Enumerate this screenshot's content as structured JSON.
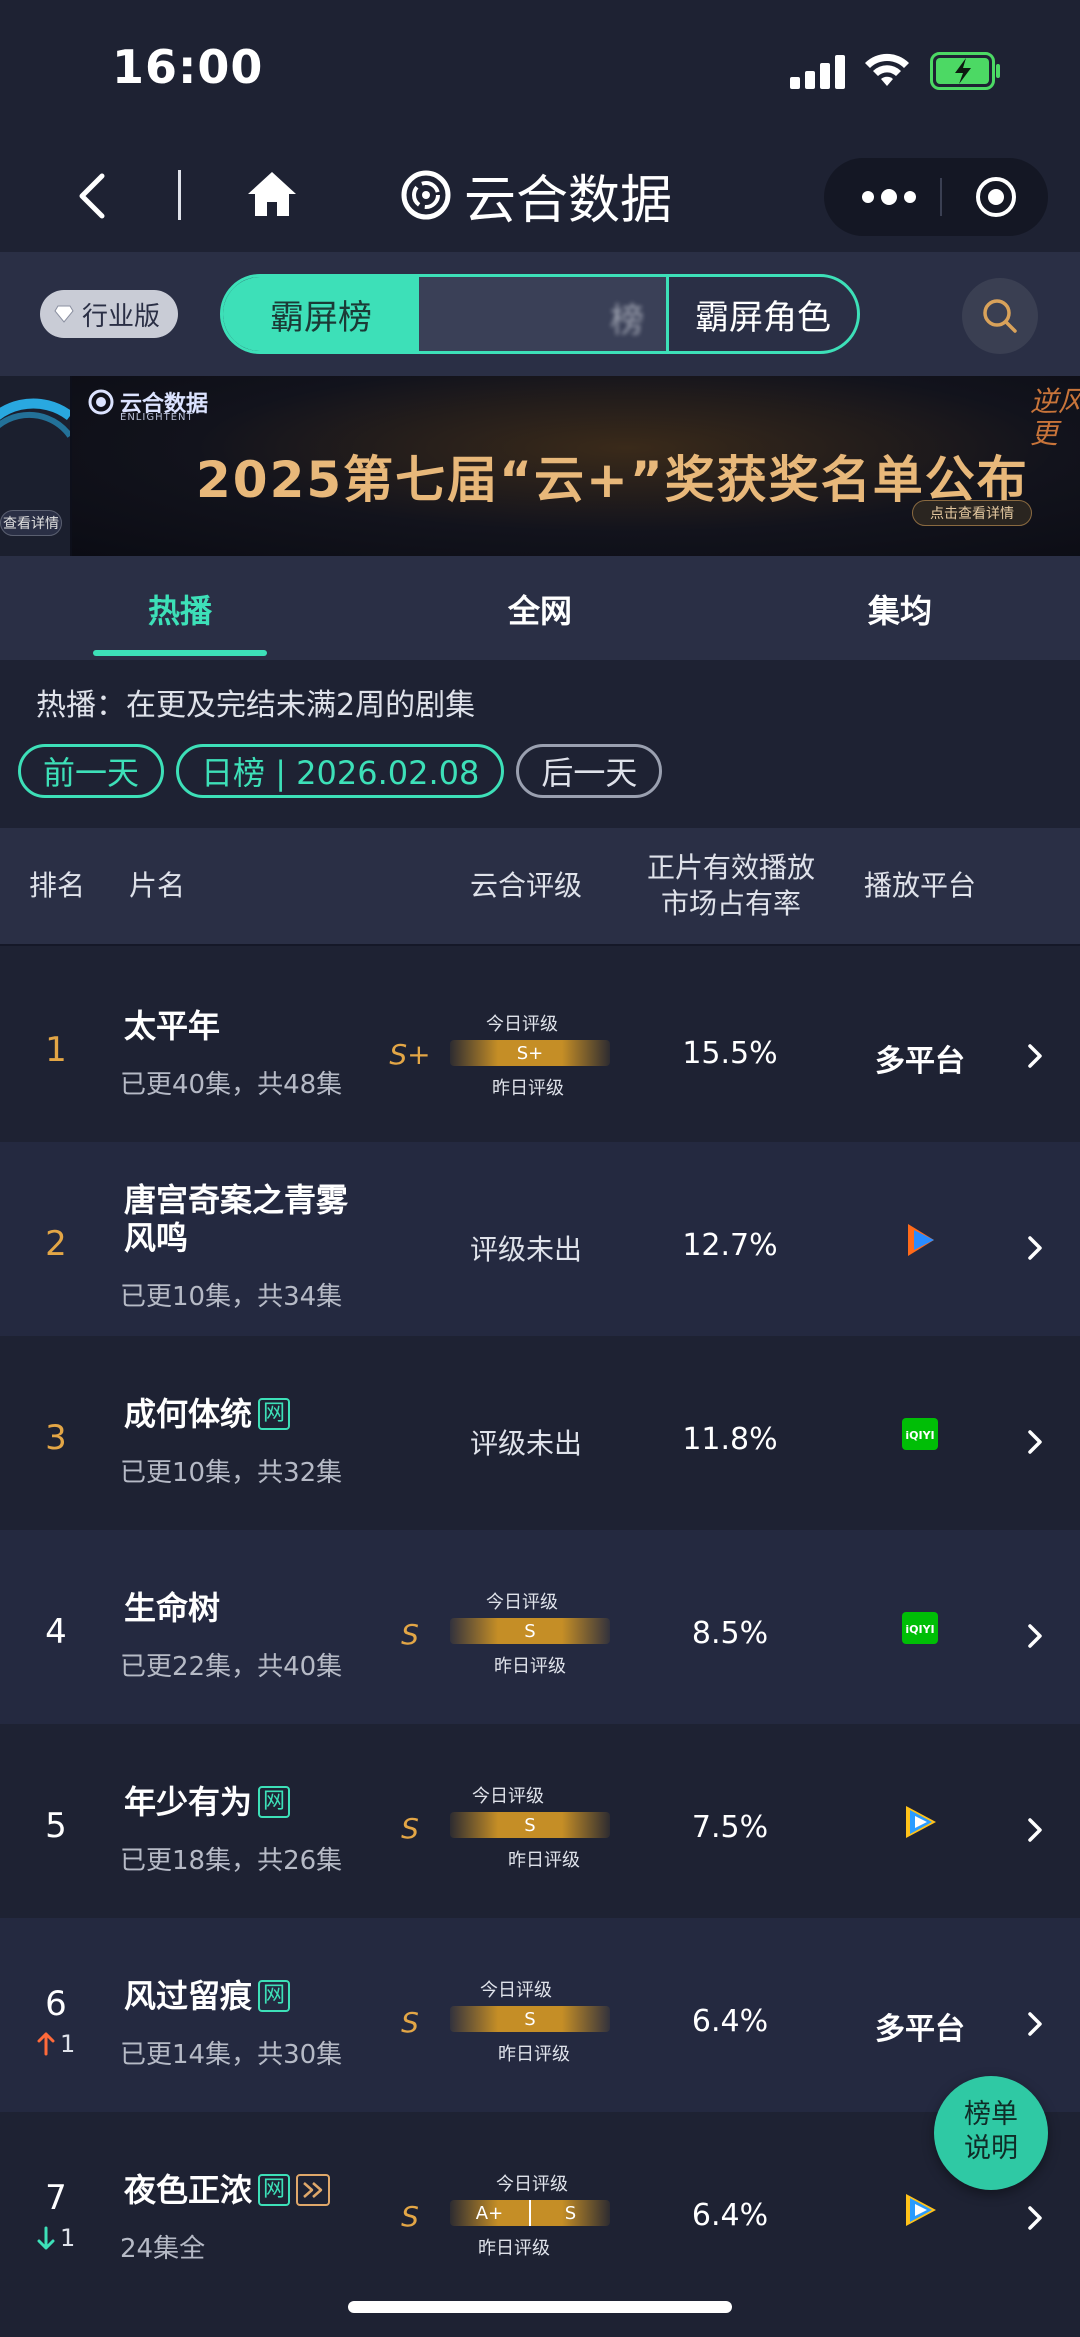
{
  "status": {
    "time": "16:00"
  },
  "nav": {
    "title": "云合数据"
  },
  "filter": {
    "edition": "行业版",
    "segments": [
      "霸屏榜",
      "榜",
      "霸屏角色"
    ]
  },
  "banner": {
    "brand": "云合数据",
    "brand_en": "ENLIGHTENT",
    "headline": "2025第七届“云+”奖获奖名单公布",
    "cta": "点击查看详情",
    "left_cta": "查看详情",
    "right_peek": "逆风更"
  },
  "tabs": [
    "热播",
    "全网",
    "集均"
  ],
  "description": "热播：在更及完结未满2周的剧集",
  "date": {
    "prev": "前一天",
    "current": "日榜 | 2026.02.08",
    "next": "后一天"
  },
  "table_header": {
    "rank": "排名",
    "title": "片名",
    "grade": "云合评级",
    "share_line1": "正片有效播放",
    "share_line2": "市场占有率",
    "platform": "播放平台"
  },
  "grade_labels": {
    "today": "今日评级",
    "yesterday": "昨日评级"
  },
  "rows": [
    {
      "rank": "1",
      "title": "太平年",
      "sub": "已更40集，共48集",
      "grade": "S+",
      "bar": "S+",
      "share": "15.5%",
      "platform": "多平台"
    },
    {
      "rank": "2",
      "title": "唐宫奇案之青雾",
      "title2": "风鸣",
      "sub": "已更10集，共34集",
      "grade_text": "评级未出",
      "share": "12.7%",
      "platform_icon": "tencent-video"
    },
    {
      "rank": "3",
      "title": "成何体统",
      "badge": "网",
      "sub": "已更10集，共32集",
      "grade_text": "评级未出",
      "share": "11.8%",
      "platform_icon": "iqiyi"
    },
    {
      "rank": "4",
      "title": "生命树",
      "sub": "已更22集，共40集",
      "grade": "S",
      "bar": "S",
      "share": "8.5%",
      "platform_icon": "iqiyi"
    },
    {
      "rank": "5",
      "title": "年少有为",
      "badge": "网",
      "sub": "已更18集，共26集",
      "grade": "S",
      "bar": "S",
      "share": "7.5%",
      "platform_icon": "tencent-video"
    },
    {
      "rank": "6",
      "change": "1",
      "title": "风过留痕",
      "badge": "网",
      "sub": "已更14集，共30集",
      "grade": "S",
      "bar": "S",
      "share": "6.4%",
      "platform": "多平台"
    },
    {
      "rank": "7",
      "change": "1",
      "title": "夜色正浓",
      "badge": "网",
      "sub": "24集全",
      "grade": "S",
      "bar_left": "A+",
      "bar_right": "S",
      "share": "6.4%",
      "platform_icon": "tencent-video"
    }
  ],
  "float_button": {
    "line1": "榜单",
    "line2": "说明"
  },
  "colors": {
    "accent": "#3de0b8",
    "gold": "#e3a646",
    "bg": "#1e2233",
    "panel": "#2a2f45"
  }
}
